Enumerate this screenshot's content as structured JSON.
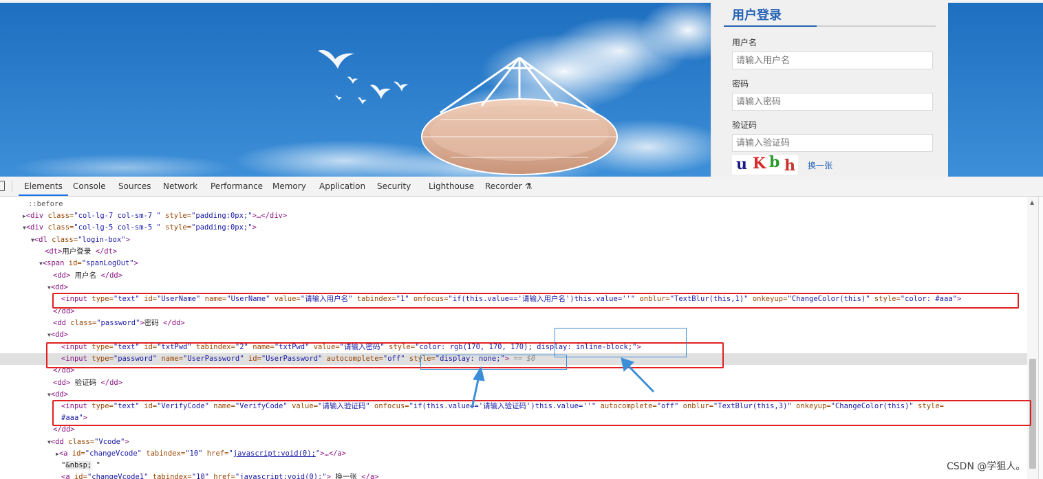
{
  "login": {
    "title": "用户登录",
    "username_label": "用户名",
    "username_placeholder": "请输入用户名",
    "password_label": "密码",
    "password_placeholder": "请输入密码",
    "verify_label": "验证码",
    "verify_placeholder": "请输入验证码",
    "captcha_chars": [
      "u",
      "K",
      "b",
      "h"
    ],
    "captcha_colors": [
      "#1a1a8a",
      "#d42a2a",
      "#2a9a2a",
      "#c8302a"
    ],
    "refresh_label": "换一张",
    "accent_color": "#2563b5"
  },
  "devtools": {
    "tabs": [
      {
        "label": "Elements",
        "active": true
      },
      {
        "label": "Console"
      },
      {
        "label": "Sources"
      },
      {
        "label": "Network"
      },
      {
        "label": "Performance"
      },
      {
        "label": "Memory"
      },
      {
        "label": "Application"
      },
      {
        "label": "Security"
      },
      {
        "label": "Lighthouse"
      },
      {
        "label": "Recorder ⚗"
      }
    ],
    "code": {
      "before": "::before",
      "div1_tag": "<div",
      "div1_attr": " class=",
      "div1_val": "\"col-lg-7 col-sm-7 \"",
      "div1_attr2": " style=",
      "div1_val2": "\"padding:0px;\"",
      "div1_end": ">…</div>",
      "div2_tag": "<div",
      "div2_attr": " class=",
      "div2_val": "\"col-lg-5 col-sm-5 \"",
      "div2_attr2": " style=",
      "div2_val2": "\"padding:0px;\"",
      "div2_end": ">",
      "dl_tag": "<dl",
      "dl_attr": " class=",
      "dl_val": "\"login-box\"",
      "dl_end": ">",
      "dt_open": "<dt>",
      "dt_text": "用户登录 ",
      "dt_close": "</dt>",
      "span_tag": "<span",
      "span_attr": " id=",
      "span_val": "\"spanLogOut\"",
      "span_end": ">",
      "dd1_open": "<dd>",
      "dd1_text": " 用户名 ",
      "dd1_close": "</dd>",
      "dd_open": "<dd>",
      "input1": {
        "tag": "<input",
        "a1": " type=",
        "v1": "\"text\"",
        "a2": " id=",
        "v2": "\"UserName\"",
        "a3": " name=",
        "v3": "\"UserName\"",
        "a4": " value=",
        "v4": "\"请输入用户名\"",
        "a5": " tabindex=",
        "v5": "\"1\"",
        "a6": " onfocus=",
        "v6": "\"if(this.value=='请输入用户名')this.value=''\"",
        "a7": " onblur=",
        "v7": "\"TextBlur(this,1)\"",
        "a8": " onkeyup=",
        "v8": "\"ChangeColor(this)\"",
        "a9": " style=",
        "v9": "\"color: #aaa\"",
        "end": ">"
      },
      "dd_close": "</dd>",
      "dd2_tag": "<dd",
      "dd2_attr": " class=",
      "dd2_val": "\"password\"",
      "dd2_text": "密码 ",
      "dd2_close": "</dd>",
      "input2": {
        "tag": "<input",
        "a1": " type=",
        "v1": "\"text\"",
        "a2": " id=",
        "v2": "\"txtPwd\"",
        "a3": " tabindex=",
        "v3": "\"2\"",
        "a4": " name=",
        "v4": "\"txtPwd\"",
        "a5": " value=",
        "v5": "\"请输入密码\"",
        "a6": " style=",
        "v6": "\"color: rgb(170, 170, 170); display: inline-block;\"",
        "end": ">"
      },
      "input3": {
        "tag": "<input",
        "a1": " type=",
        "v1": "\"password\"",
        "a2": " name=",
        "v2": "\"UserPassword\"",
        "a3": " id=",
        "v3": "\"UserPassword\"",
        "a4": " autocomplete=",
        "v4": "\"off\"",
        "a5": " style=",
        "v5": "\"display: none;\"",
        "end": ">",
        "eq": " == $0"
      },
      "dd3_text": " 验证码 ",
      "input4": {
        "tag": "<input",
        "a1": " type=",
        "v1": "\"text\"",
        "a2": " id=",
        "v2": "\"VerifyCode\"",
        "a3": " name=",
        "v3": "\"VerifyCode\"",
        "a4": " value=",
        "v4": "\"请输入验证码\"",
        "a5": " onfocus=",
        "v5": "\"if(this.value=='请输入验证码')this.value=''\"",
        "a6": " autocomplete=",
        "v6": "\"off\"",
        "a7": " onblur=",
        "v7": "\"TextBlur(this,3)\"",
        "a8": " onkeyup=",
        "v8": "\"ChangeColor(this)\"",
        "a9": " style=",
        "v9": "\"color:",
        "cont": "#aaa\"",
        "end": ">"
      },
      "dd4_tag": "<dd",
      "dd4_attr": " class=",
      "dd4_val": "\"Vcode\"",
      "dd4_end": ">",
      "a1_tag": "<a",
      "a1_attr": " id=",
      "a1_val": "\"changeVcode\"",
      "a1_attr2": " tabindex=",
      "a1_val2": "\"10\"",
      "a1_attr3": " href=",
      "a1_val3": "\"javascript:void(0);\"",
      "a1_end": ">…</a>",
      "nbsp_q1": "\"",
      "nbsp": "&nbsp;",
      "nbsp_q2": " \"",
      "a2_tag": "<a",
      "a2_attr": " id=",
      "a2_val": "\"changeVcode1\"",
      "a2_attr2": " tabindex=",
      "a2_val2": "\"10\"",
      "a2_attr3": " href=",
      "a2_val3": "\"javascript:void(0);\"",
      "a2_gt": ">",
      "a2_text": " 换一张 ",
      "a2_close": "</a>"
    }
  },
  "watermark": "CSDN @学狙人。",
  "colors": {
    "annotation_red": "#e02020",
    "annotation_blue": "#3b8ed8"
  }
}
